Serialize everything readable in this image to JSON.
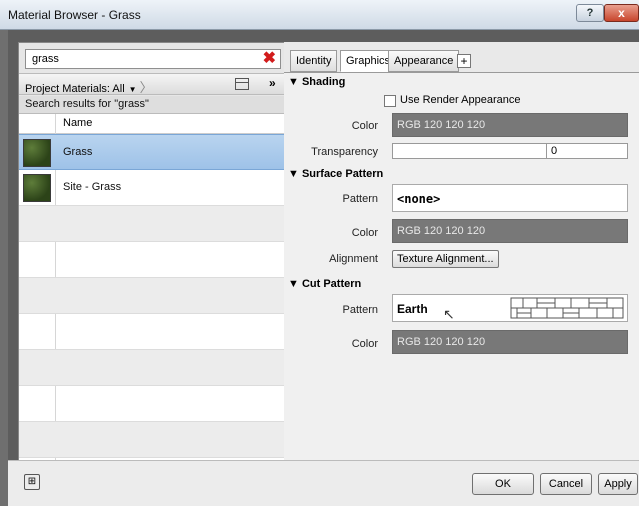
{
  "window": {
    "title": "Material Browser - Grass",
    "help_label": "?",
    "close_label": "x"
  },
  "search": {
    "value": "grass",
    "clear_label": "✖"
  },
  "library": {
    "dropdown_label": "Project Materials: All",
    "results_label": "Search results for \"grass\"",
    "more_label": "»"
  },
  "list": {
    "column_name": "Name",
    "items": [
      {
        "label": "Grass",
        "selected": true
      },
      {
        "label": "Site - Grass",
        "selected": false
      }
    ]
  },
  "left_tools": {
    "collapse_label": "«"
  },
  "tabs": [
    {
      "label": "Identity",
      "active": false
    },
    {
      "label": "Graphics",
      "active": true
    },
    {
      "label": "Appearance",
      "active": false
    }
  ],
  "tab_add_label": "+",
  "shading": {
    "heading": "▼ Shading",
    "use_render_label": "Use Render Appearance",
    "color_label": "Color",
    "color_value": "RGB 120 120 120",
    "transparency_label": "Transparency",
    "transparency_value": "0"
  },
  "surface_pattern": {
    "heading": "▼ Surface Pattern",
    "pattern_label": "Pattern",
    "pattern_value": "<none>",
    "color_label": "Color",
    "color_value": "RGB 120 120 120",
    "alignment_label": "Alignment",
    "alignment_button": "Texture Alignment..."
  },
  "cut_pattern": {
    "heading": "▼ Cut Pattern",
    "pattern_label": "Pattern",
    "pattern_value": "Earth",
    "color_label": "Color",
    "color_value": "RGB 120 120 120"
  },
  "buttons": {
    "ok": "OK",
    "cancel": "Cancel",
    "apply": "Apply"
  },
  "colors": {
    "swatch": "#787878",
    "selection": "#9ec2e8"
  }
}
